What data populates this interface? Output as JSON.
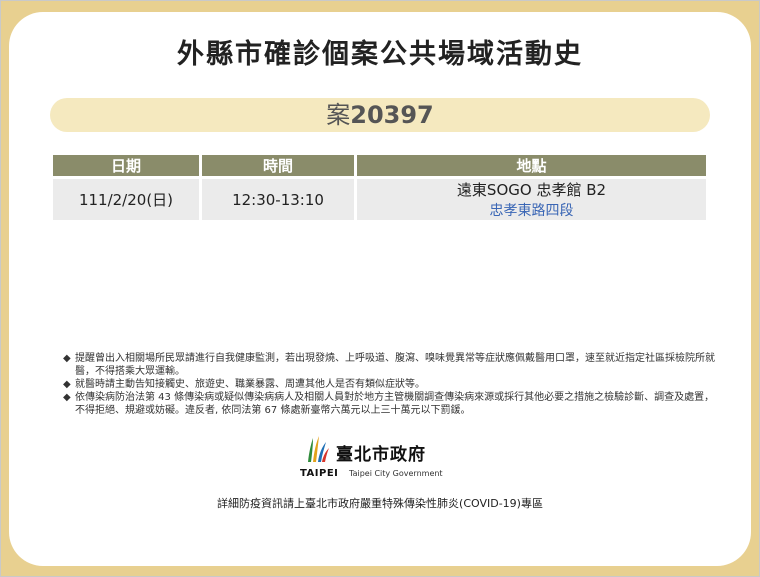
{
  "page": {
    "title": "外縣市確診個案公共場域活動史",
    "case": {
      "prefix": "案",
      "number": "20397"
    }
  },
  "table": {
    "headers": [
      "日期",
      "時間",
      "地點"
    ],
    "rows": [
      {
        "date": "111/2/20(日)",
        "time": "12:30-13:10",
        "place": "遠東SOGO 忠孝館 B2",
        "address": "忠孝東路四段"
      }
    ]
  },
  "notes": [
    {
      "bullet": "◆",
      "text": "提醒曾出入相關場所民眾請進行自我健康監測，若出現發燒、上呼吸道、腹瀉、嗅味覺異常等症狀應佩戴醫用口罩，速至就近指定社區採檢院所就醫，不得搭乘大眾運輸。"
    },
    {
      "bullet": "◆",
      "text": "就醫時請主動告知接觸史、旅遊史、職業暴露、周遭其他人是否有類似症狀等。"
    },
    {
      "bullet": "◆",
      "text": "依傳染病防治法第 43 條傳染病或疑似傳染病病人及相關人員對於地方主管機關調查傳染病來源或採行其他必要之措施之檢驗診斷、調查及處置，不得拒絕、規避或妨礙。違反者, 依同法第 67 條處新臺幣六萬元以上三十萬元以下罰鍰。"
    }
  ],
  "logo": {
    "zh": "臺北市政府",
    "mark_text": "TAIPEI",
    "en": "Taipei City Government",
    "icon": "taipei-city-logo-icon"
  },
  "footer": "詳細防疫資訊請上臺北市政府嚴重特殊傳染性肺炎(COVID-19)專區",
  "colors": {
    "background": "#e8d090",
    "pill": "#f5e9bf",
    "header": "#8a8c6a",
    "cell": "#ebebeb",
    "address": "#3a66b5"
  }
}
